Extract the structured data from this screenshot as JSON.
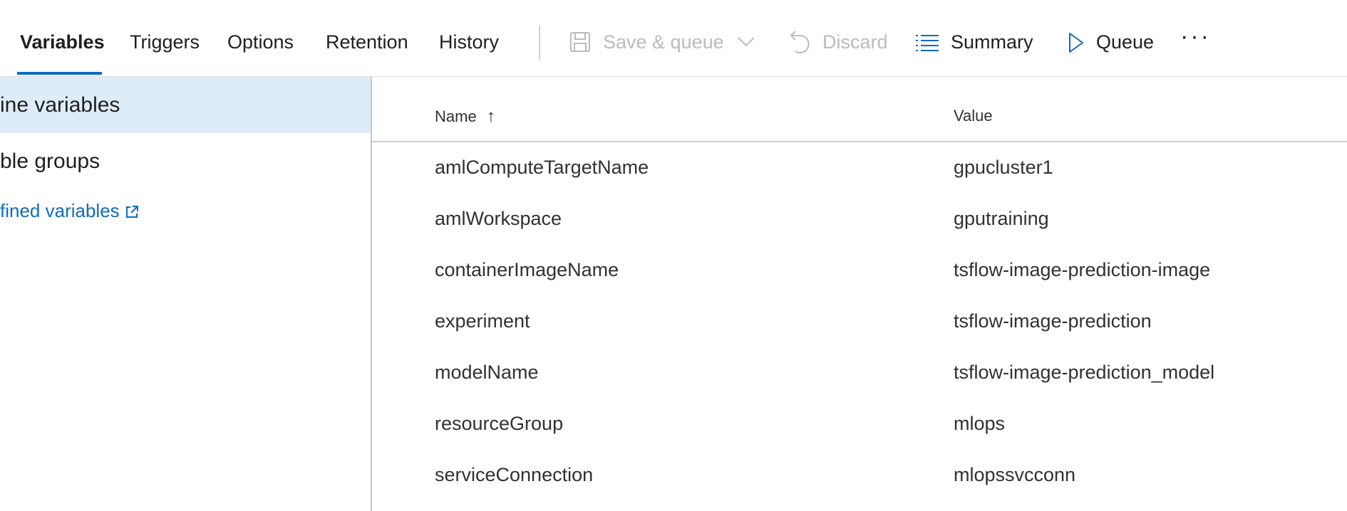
{
  "tabs": [
    {
      "label": "Variables"
    },
    {
      "label": "Triggers"
    },
    {
      "label": "Options"
    },
    {
      "label": "Retention"
    },
    {
      "label": "History"
    }
  ],
  "commands": {
    "save_queue": "Save & queue",
    "discard": "Discard",
    "summary": "Summary",
    "queue": "Queue",
    "more": "···"
  },
  "sidebar": {
    "items": [
      {
        "label": "ine variables"
      },
      {
        "label": "ble groups"
      }
    ],
    "link": "fined variables"
  },
  "table": {
    "headers": {
      "name": "Name",
      "value": "Value"
    },
    "sort_indicator": "↑",
    "rows": [
      {
        "name": "amlComputeTargetName",
        "value": "gpucluster1"
      },
      {
        "name": "amlWorkspace",
        "value": "gputraining"
      },
      {
        "name": "containerImageName",
        "value": "tsflow-image-prediction-image"
      },
      {
        "name": "experiment",
        "value": "tsflow-image-prediction"
      },
      {
        "name": "modelName",
        "value": "tsflow-image-prediction_model"
      },
      {
        "name": "resourceGroup",
        "value": "mlops"
      },
      {
        "name": "serviceConnection",
        "value": "mlopssvcconn"
      }
    ]
  },
  "colors": {
    "accent": "#0f6cbd",
    "selected_bg": "#deecf9",
    "disabled_text": "#bdbbb9"
  }
}
